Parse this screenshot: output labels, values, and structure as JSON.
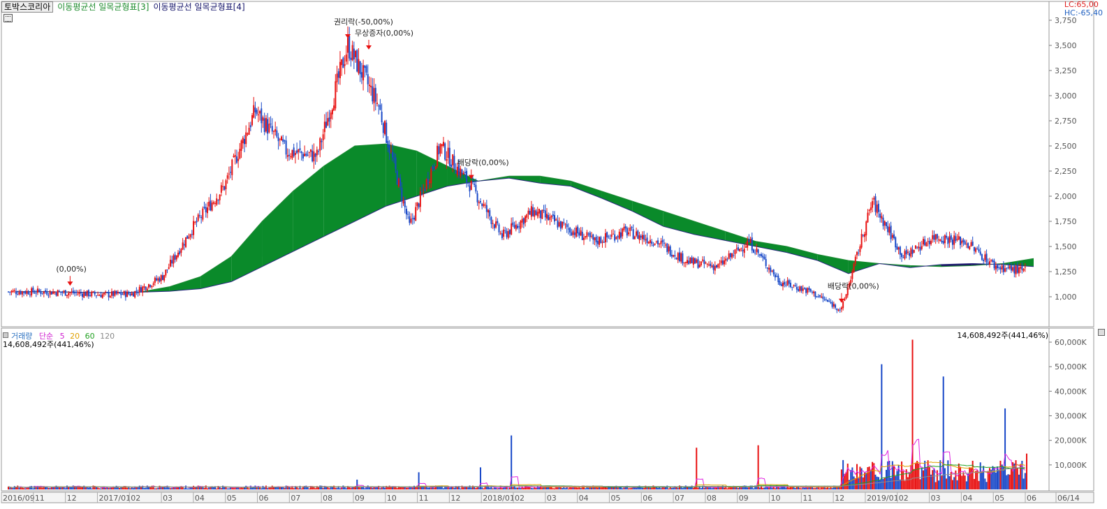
{
  "legend": {
    "stock_name": "토박스코리아",
    "ma_label_3": "이동평균선 일목균형표[3]",
    "ma_label_4": "이동평균선 일목균형표[4]"
  },
  "lc_label": "LC:65,00",
  "hc_label": "HC:-65,40",
  "volume_legend": {
    "name": "거래량",
    "type": "단순",
    "p5": "5",
    "p20": "20",
    "p60": "60",
    "p120": "120",
    "current": "14,608,492주(441,46%)"
  },
  "colors": {
    "up": "#e81010",
    "down": "#1848c8",
    "cloud_green": "#0a8a2a",
    "cloud_navy": "#1a1660",
    "axis_text": "#555555",
    "ma5": "#e020e0",
    "ma20": "#e0a000",
    "ma60": "#20a020",
    "ma120": "#909090"
  },
  "chart_data": [
    {
      "type": "candlestick",
      "title": "",
      "ylim": [
        820,
        3800
      ],
      "y_ticks": [
        "1,000",
        "1,250",
        "1,500",
        "1,750",
        "2,000",
        "2,250",
        "2,500",
        "2,750",
        "3,000",
        "3,250",
        "3,500",
        "3,750"
      ],
      "x_ticks": [
        "2016/09",
        "11",
        "12",
        "2017/01",
        "02",
        "03",
        "04",
        "05",
        "06",
        "07",
        "08",
        "09",
        "10",
        "11",
        "12",
        "2018/01",
        "02",
        "03",
        "04",
        "05",
        "06",
        "07",
        "08",
        "09",
        "10",
        "11",
        "12",
        "2019/01",
        "02",
        "03",
        "04",
        "05",
        "06",
        "06/14"
      ],
      "price_path": [
        {
          "d": "2016/09",
          "p": 1050
        },
        {
          "d": "2016/10",
          "p": 1050
        },
        {
          "d": "2016/11",
          "p": 1040
        },
        {
          "d": "2016/12",
          "p": 1020
        },
        {
          "d": "2017/01",
          "p": 1030
        },
        {
          "d": "2017/02",
          "p": 1200
        },
        {
          "d": "2017/03",
          "p": 1700
        },
        {
          "d": "2017/04",
          "p": 2100
        },
        {
          "d": "2017/05",
          "p": 2850
        },
        {
          "d": "2017/06",
          "p": 2450
        },
        {
          "d": "2017/07",
          "p": 2400
        },
        {
          "d": "2017/08",
          "p": 3500
        },
        {
          "d": "2017/09",
          "p": 2900
        },
        {
          "d": "2017/10",
          "p": 1700
        },
        {
          "d": "2017/11",
          "p": 2500
        },
        {
          "d": "2017/12",
          "p": 2100
        },
        {
          "d": "2018/01",
          "p": 1600
        },
        {
          "d": "2018/02",
          "p": 1850
        },
        {
          "d": "2018/03",
          "p": 1700
        },
        {
          "d": "2018/04",
          "p": 1550
        },
        {
          "d": "2018/05",
          "p": 1650
        },
        {
          "d": "2018/06",
          "p": 1550
        },
        {
          "d": "2018/07",
          "p": 1350
        },
        {
          "d": "2018/08",
          "p": 1300
        },
        {
          "d": "2018/09",
          "p": 1550
        },
        {
          "d": "2018/10",
          "p": 1150
        },
        {
          "d": "2018/11",
          "p": 1050
        },
        {
          "d": "2018/12",
          "p": 870
        },
        {
          "d": "2019/01",
          "p": 1950
        },
        {
          "d": "2019/02",
          "p": 1400
        },
        {
          "d": "2019/03",
          "p": 1600
        },
        {
          "d": "2019/04",
          "p": 1550
        },
        {
          "d": "2019/05",
          "p": 1300
        },
        {
          "d": "2019/06",
          "p": 1250
        }
      ],
      "ichimoku_span_a": [
        1050,
        1050,
        1045,
        1040,
        1045,
        1100,
        1200,
        1400,
        1750,
        2050,
        2300,
        2500,
        2520,
        2450,
        2300,
        2150,
        2200,
        2200,
        2150,
        2050,
        1950,
        1850,
        1750,
        1650,
        1550,
        1500,
        1420,
        1360,
        1330,
        1310,
        1300,
        1310,
        1330,
        1380
      ],
      "ichimoku_span_b": [
        1050,
        1050,
        1045,
        1040,
        1045,
        1055,
        1080,
        1150,
        1300,
        1450,
        1600,
        1750,
        1900,
        2000,
        2100,
        2150,
        2180,
        2130,
        2100,
        1980,
        1850,
        1700,
        1620,
        1560,
        1500,
        1440,
        1360,
        1230,
        1330,
        1290,
        1320,
        1330,
        1320,
        1300
      ],
      "annotations": [
        {
          "text": "(0,00%)",
          "date": "2016/11"
        },
        {
          "text": "권리락(-50,00%)",
          "date": "2017/08"
        },
        {
          "text": "무상증자(0,00%)",
          "date": "2017/08"
        },
        {
          "text": "배당락(0,00%)",
          "date": "2017/12"
        },
        {
          "text": "배당락(0,00%)",
          "date": "2018/12"
        }
      ]
    },
    {
      "type": "bar",
      "title": "거래량",
      "ylim": [
        0,
        65000
      ],
      "y_ticks": [
        "10,000K",
        "20,000K",
        "30,000K",
        "40,000K",
        "50,000K",
        "60,000K"
      ],
      "volume_spikes": [
        {
          "d": "2017/08",
          "v": 4000
        },
        {
          "d": "2017/10",
          "v": 7000
        },
        {
          "d": "2017/12",
          "v": 9000
        },
        {
          "d": "2018/01",
          "v": 22000
        },
        {
          "d": "2018/07",
          "v": 17000
        },
        {
          "d": "2018/09",
          "v": 18000
        },
        {
          "d": "2019/01",
          "v": 51000
        },
        {
          "d": "2019/02",
          "v": 61000
        },
        {
          "d": "2019/03",
          "v": 46000
        },
        {
          "d": "2019/05",
          "v": 33000
        },
        {
          "d": "2019/06",
          "v": 14608
        }
      ]
    }
  ]
}
